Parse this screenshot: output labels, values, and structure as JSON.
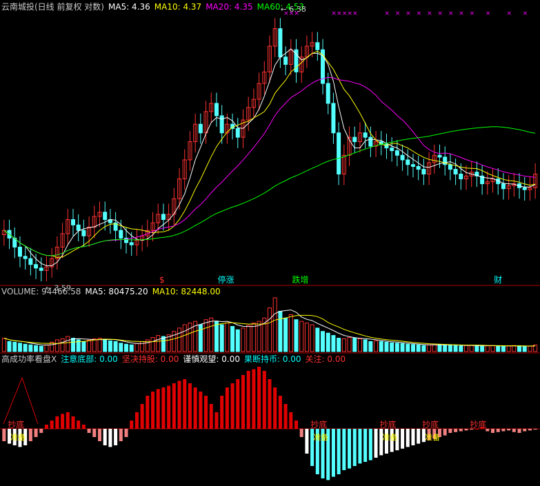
{
  "header": {
    "main": [
      {
        "text": "云南城投(日线 前复权 对数)",
        "color": "#c8c8c8"
      },
      {
        "text": "MA5: 4.36",
        "color": "#ffffff"
      },
      {
        "text": "MA10: 4.37",
        "color": "#ffff00"
      },
      {
        "text": "MA20: 4.35",
        "color": "#ff00ff"
      },
      {
        "text": "MA60: 4.53",
        "color": "#00ff00"
      }
    ],
    "volume": [
      {
        "text": "VOLUME: 94466.58",
        "color": "#c8c8c8"
      },
      {
        "text": "MA5: 80475.20",
        "color": "#ffffff"
      },
      {
        "text": "MA10: 82448.00",
        "color": "#ffff00"
      }
    ],
    "indicator": [
      {
        "text": "高成功率看盘X",
        "color": "#c8c8c8"
      },
      {
        "text": "注意底部: 0.00",
        "color": "#00ffff"
      },
      {
        "text": "坚决持股: 0.00",
        "color": "#ff3030"
      },
      {
        "text": "谨慎观望: 0.00",
        "color": "#ffffff"
      },
      {
        "text": "果断持币: 0.00",
        "color": "#00ffff"
      },
      {
        "text": "关注: 0.00",
        "color": "#ff3030"
      }
    ]
  },
  "colors": {
    "background": "#000000",
    "up": "#ff3232",
    "down": "#54ffff",
    "ma5": "#ffffff",
    "ma10": "#ffff00",
    "ma20": "#ff00ff",
    "ma60": "#00ff00",
    "separator": "#b00000",
    "marker": "#ff00ff"
  },
  "chart_data": [
    {
      "type": "candlestick",
      "scale": "log",
      "price_range": [
        3.5,
        6.5
      ],
      "high_label": "6.38",
      "low_label": "3.59",
      "close": [
        3.95,
        3.88,
        3.8,
        3.72,
        3.7,
        3.65,
        3.62,
        3.6,
        3.63,
        3.7,
        3.8,
        3.92,
        4.05,
        4.0,
        3.95,
        3.9,
        3.98,
        4.08,
        4.12,
        4.05,
        4.02,
        3.95,
        3.88,
        3.84,
        3.82,
        3.86,
        3.9,
        3.95,
        4.02,
        4.1,
        4.05,
        4.1,
        4.25,
        4.45,
        4.65,
        4.85,
        5.05,
        4.95,
        5.2,
        5.3,
        5.15,
        4.95,
        5.05,
        5.0,
        4.9,
        5.1,
        5.25,
        5.35,
        5.55,
        5.7,
        6.05,
        6.3,
        5.9,
        5.8,
        6.0,
        5.7,
        5.9,
        6.05,
        6.1,
        6.0,
        5.55,
        5.3,
        4.95,
        4.5,
        4.7,
        4.9,
        4.85,
        4.95,
        4.9,
        4.8,
        4.85,
        4.82,
        4.78,
        4.75,
        4.7,
        4.65,
        4.6,
        4.58,
        4.55,
        4.5,
        4.62,
        4.7,
        4.68,
        4.6,
        4.55,
        4.5,
        4.45,
        4.48,
        4.52,
        4.48,
        4.4,
        4.42,
        4.45,
        4.4,
        4.35,
        4.38,
        4.4,
        4.36,
        4.34,
        4.36,
        4.5
      ],
      "markers": {
        "up_arrow": [
          50,
          64,
          84
        ],
        "top_x": [
          53,
          54,
          55,
          62,
          63,
          64,
          65,
          66,
          72,
          74,
          76,
          78,
          80,
          82,
          84,
          86,
          88,
          91,
          95,
          98
        ]
      },
      "bottom_labels": [
        {
          "text": "$",
          "color": "#ff3030",
          "bar": 30
        },
        {
          "text": "停涨",
          "color": "#00ffff",
          "bar": 41
        },
        {
          "text": "跌增",
          "color": "#00ff00",
          "bar": 55
        },
        {
          "text": "财",
          "color": "#00ffff",
          "bar": 93
        }
      ]
    },
    {
      "type": "bar",
      "name": "volume",
      "values": [
        40,
        30,
        28,
        25,
        22,
        20,
        18,
        16,
        20,
        28,
        35,
        38,
        45,
        40,
        35,
        30,
        34,
        38,
        40,
        36,
        32,
        30,
        25,
        22,
        20,
        24,
        30,
        35,
        42,
        48,
        45,
        50,
        60,
        70,
        80,
        85,
        90,
        80,
        95,
        100,
        90,
        80,
        85,
        75,
        65,
        70,
        78,
        85,
        90,
        100,
        130,
        160,
        120,
        100,
        110,
        95,
        90,
        85,
        80,
        70,
        60,
        55,
        48,
        40,
        38,
        42,
        40,
        38,
        35,
        30,
        32,
        30,
        28,
        26,
        25,
        24,
        22,
        21,
        20,
        18,
        20,
        22,
        21,
        20,
        19,
        18,
        17,
        18,
        19,
        18,
        16,
        17,
        18,
        17,
        16,
        17,
        18,
        16,
        15,
        16,
        20
      ]
    },
    {
      "type": "bar",
      "name": "indicator",
      "values": [
        -15,
        -18,
        -20,
        -22,
        -20,
        -15,
        -10,
        -5,
        5,
        10,
        15,
        18,
        20,
        15,
        10,
        5,
        -5,
        -10,
        -15,
        -20,
        -22,
        -20,
        -15,
        -10,
        10,
        20,
        30,
        40,
        45,
        48,
        50,
        52,
        55,
        58,
        60,
        55,
        50,
        45,
        40,
        30,
        20,
        40,
        50,
        55,
        60,
        65,
        70,
        72,
        75,
        70,
        60,
        50,
        40,
        30,
        20,
        10,
        -10,
        -30,
        -45,
        -55,
        -60,
        -62,
        -58,
        -55,
        -50,
        -48,
        -45,
        -42,
        -40,
        -38,
        -35,
        -32,
        -30,
        -28,
        -26,
        -24,
        -22,
        -20,
        -18,
        -16,
        -14,
        -12,
        -10,
        -8,
        -5,
        -4,
        -3,
        -2,
        -1,
        0,
        2,
        -3,
        -5,
        -4,
        -3,
        -2,
        -4,
        -5,
        -3,
        -2,
        -1
      ],
      "labels": [
        {
          "text": "抄底",
          "bar": 2,
          "sub": "准备"
        },
        {
          "text": "抄底",
          "bar": 59,
          "sub": "准备"
        },
        {
          "text": "抄底",
          "bar": 72,
          "sub": "准备"
        },
        {
          "text": "抄底",
          "bar": 80,
          "sub": "准备"
        },
        {
          "text": "抄底",
          "bar": 89,
          "sub": ""
        }
      ]
    }
  ]
}
